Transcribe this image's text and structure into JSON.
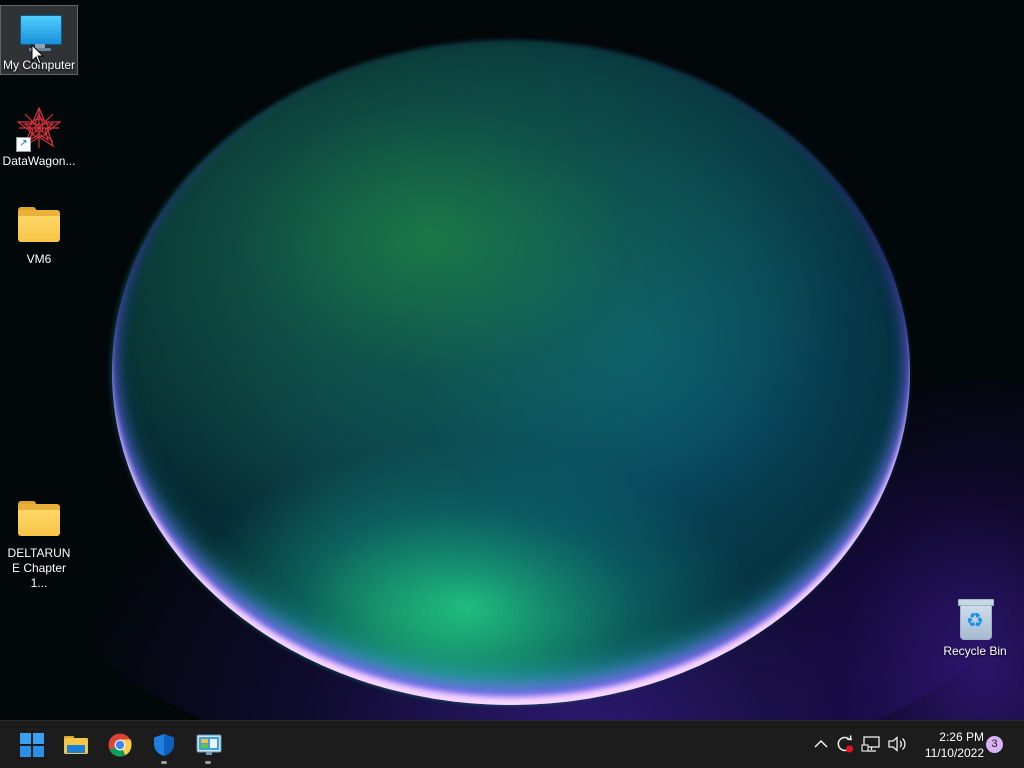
{
  "desktop": {
    "icons": [
      {
        "label": "My Computer",
        "icon": "monitor-icon"
      },
      {
        "label": "DataWagon...",
        "icon": "datawagon-app-icon"
      },
      {
        "label": "VM6",
        "icon": "folder-icon"
      },
      {
        "label": "DELTARUNE Chapter 1...",
        "icon": "folder-icon"
      },
      {
        "label": "Recycle Bin",
        "icon": "recycle-bin-icon"
      }
    ]
  },
  "taskbar": {
    "pinned": [
      {
        "name": "start",
        "icon": "windows-logo-icon"
      },
      {
        "name": "file-explorer",
        "icon": "folder-icon"
      },
      {
        "name": "chrome",
        "icon": "chrome-icon"
      },
      {
        "name": "windows-security",
        "icon": "shield-icon"
      },
      {
        "name": "control-panel",
        "icon": "control-panel-icon"
      }
    ],
    "tray": {
      "icons": [
        "chevron-up-icon",
        "sync-icon",
        "network-icon",
        "volume-icon"
      ],
      "time": "2:26 PM",
      "date": "11/10/2022",
      "notification_count": "3"
    }
  },
  "colors": {
    "taskbar_bg": "#1c1c1c",
    "accent": "#0078d4",
    "folder": "#f6c447",
    "notification_badge": "#d9b3f5"
  }
}
